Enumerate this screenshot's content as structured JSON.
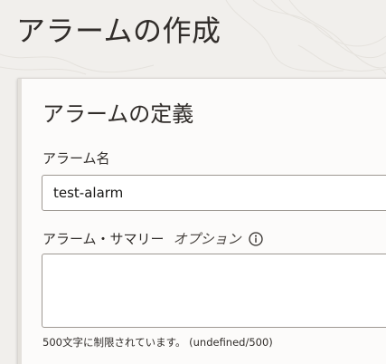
{
  "page": {
    "title": "アラームの作成"
  },
  "panel": {
    "section_title": "アラームの定義",
    "alarm_name": {
      "label": "アラーム名",
      "value": "test-alarm"
    },
    "alarm_summary": {
      "label": "アラーム・サマリー",
      "optional_label": "オプション",
      "info_icon": "info-circle-icon",
      "value": "",
      "helper": "500文字に制限されています。",
      "counter": "(undefined/500)"
    }
  },
  "colors": {
    "background": "#f1efec",
    "panel": "#fcfbfa",
    "text": "#312d2a",
    "input_border": "#9e9892"
  }
}
